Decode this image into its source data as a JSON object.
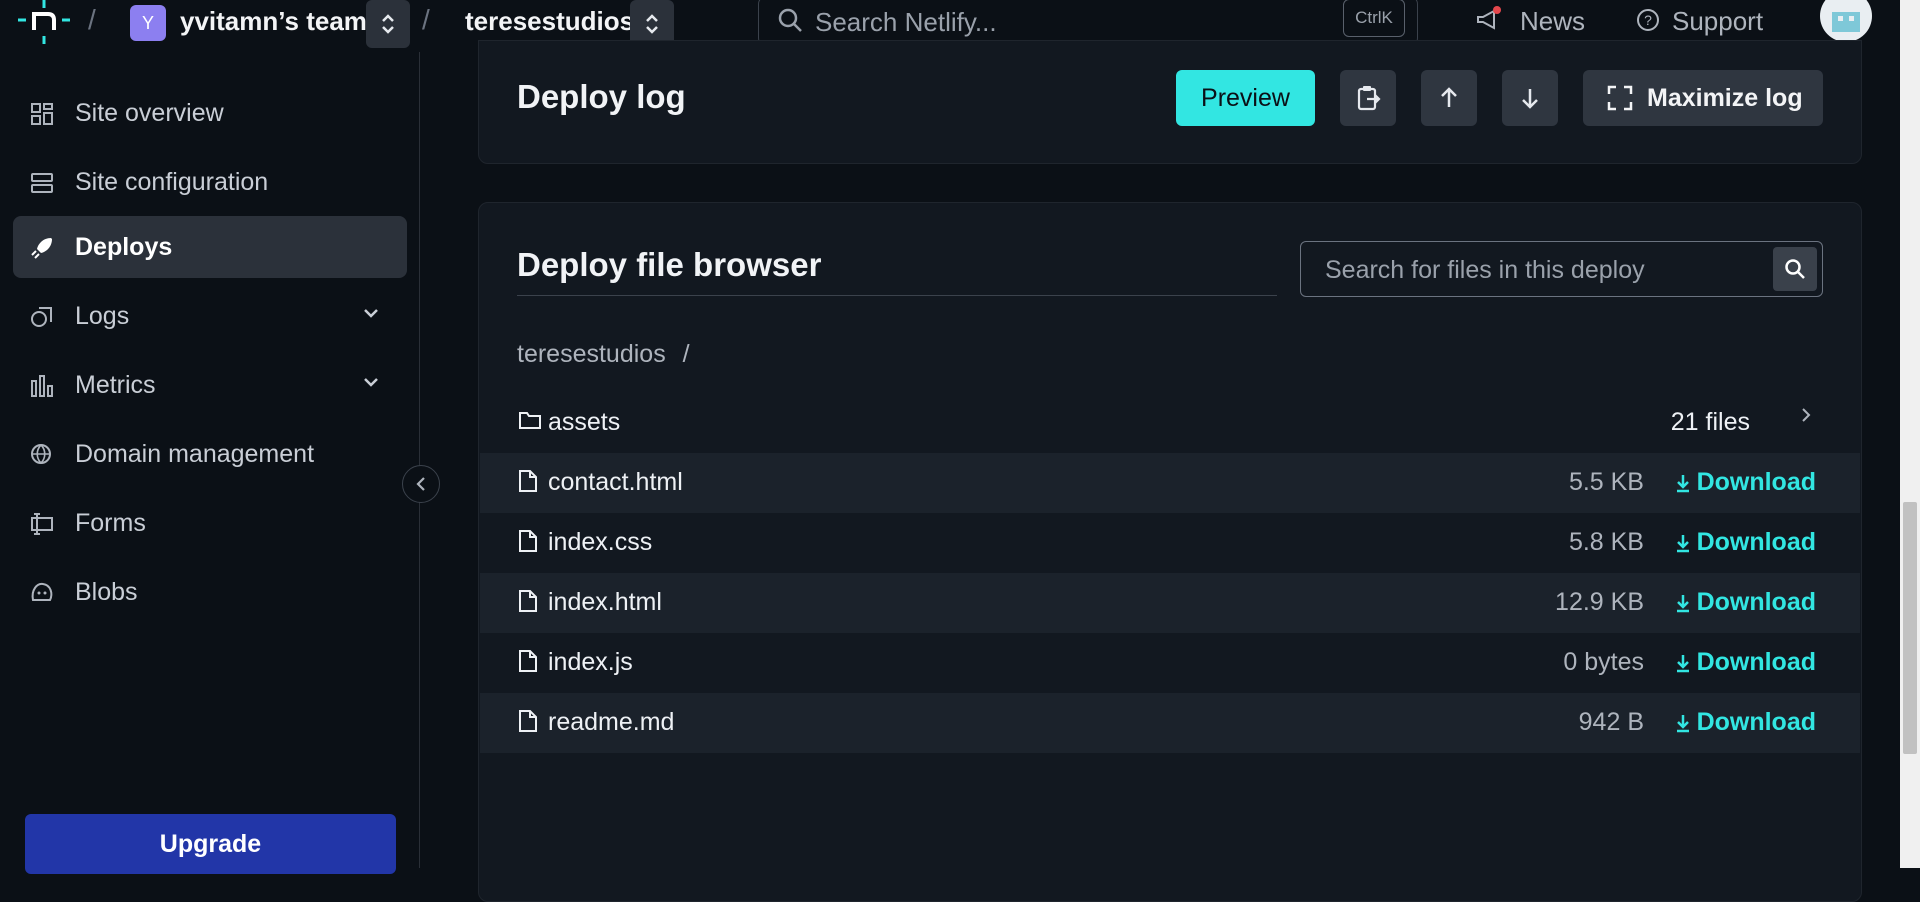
{
  "topbar": {
    "team_initial": "Y",
    "team_name": "yvitamn’s team",
    "site_name": "teresestudios",
    "search_placeholder": "Search Netlify...",
    "search_shortcut": "CtrlK",
    "news_label": "News",
    "support_label": "Support"
  },
  "sidebar": {
    "items": [
      {
        "label": "Site overview",
        "icon": "grid-icon"
      },
      {
        "label": "Site configuration",
        "icon": "config-icon"
      },
      {
        "label": "Deploys",
        "icon": "rocket-icon",
        "active": true
      },
      {
        "label": "Logs",
        "icon": "logs-icon",
        "expandable": true
      },
      {
        "label": "Metrics",
        "icon": "chart-icon",
        "expandable": true
      },
      {
        "label": "Domain management",
        "icon": "globe-icon"
      },
      {
        "label": "Forms",
        "icon": "forms-icon"
      },
      {
        "label": "Blobs",
        "icon": "blobs-icon"
      }
    ],
    "upgrade_label": "Upgrade"
  },
  "deploy_log": {
    "title": "Deploy log",
    "preview_label": "Preview",
    "maximize_label": "Maximize log"
  },
  "file_browser": {
    "title": "Deploy file browser",
    "search_placeholder": "Search for files in this deploy",
    "breadcrumb_root": "teresestudios",
    "breadcrumb_sep": "/",
    "download_label": "Download",
    "folders": [
      {
        "name": "assets",
        "count": "21 files"
      }
    ],
    "files": [
      {
        "name": "contact.html",
        "size": "5.5 KB"
      },
      {
        "name": "index.css",
        "size": "5.8 KB"
      },
      {
        "name": "index.html",
        "size": "12.9 KB"
      },
      {
        "name": "index.js",
        "size": "0 bytes"
      },
      {
        "name": "readme.md",
        "size": "942 B"
      }
    ]
  },
  "colors": {
    "accent": "#32e6e2",
    "background": "#0b1016",
    "panel": "#121820",
    "upgrade": "#2236a8"
  }
}
